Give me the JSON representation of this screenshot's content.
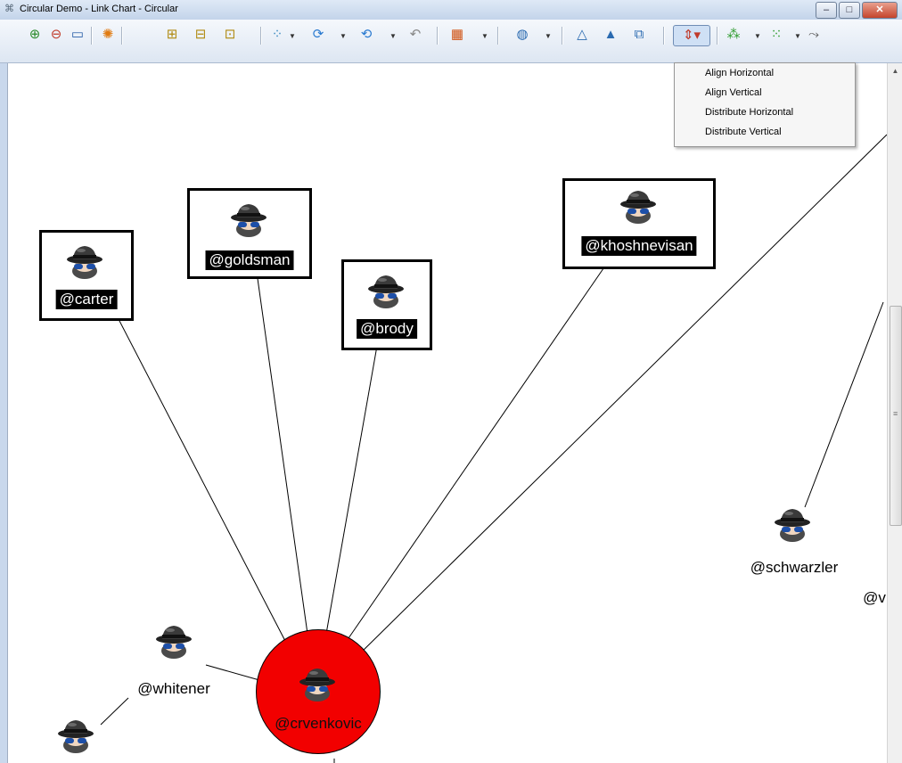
{
  "window": {
    "title": "Circular Demo - Link Chart - Circular",
    "controls": [
      "–",
      "□",
      "✕"
    ]
  },
  "toolbar": {
    "icons": [
      "zoom-in-icon",
      "zoom-out-icon",
      "fit-window-icon",
      "highlight-icon",
      "fit-all-icon",
      "fit-vertical-icon",
      "fit-horizontal-icon",
      "layout-icon",
      "refresh-icon",
      "refresh-layout-icon",
      "undo-icon",
      "color-icon",
      "globe-icon",
      "align-top-icon",
      "align-bottom-icon",
      "export-icon",
      "align-tool-icon",
      "expand-icon",
      "nodes-icon",
      "path-icon"
    ]
  },
  "menu": {
    "items": [
      "Align Horizontal",
      "Align Vertical",
      "Distribute Horizontal",
      "Distribute Vertical"
    ]
  },
  "nodes": {
    "carter": "@carter",
    "goldsman": "@goldsman",
    "brody": "@brody",
    "khoshnevisan": "@khoshnevisan",
    "schwarzler": "@schwarzler",
    "partial_v": "@v",
    "whitener": "@whitener",
    "crvenkovic": "@crvenkovic"
  },
  "colors": {
    "center_node": "#f20000",
    "title_bar": "#c9d8ec"
  }
}
